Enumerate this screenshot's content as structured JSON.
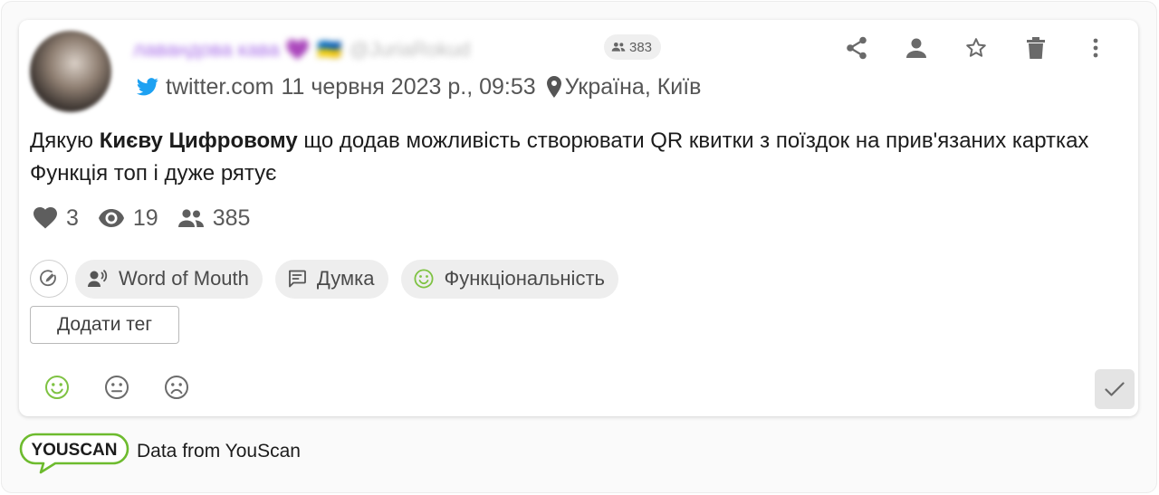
{
  "post": {
    "author_name": "лавандова кава 💜",
    "author_handle": "@JuriaRokud",
    "author_emoji": "🇺🇦",
    "audience": "383",
    "source": "twitter.com",
    "date": "11 червня 2023 р., 09:53",
    "location": "Україна, Київ",
    "text_before": "Дякую ",
    "text_bold": "Києву Цифровому",
    "text_after": " що додав можливість створювати QR квитки з поїздок на прив'язаних картках Функція топ і дуже рятує"
  },
  "stats": {
    "likes": "3",
    "views": "19",
    "reach": "385"
  },
  "tags": [
    {
      "label": "Word of Mouth",
      "icon": "speaker-person-icon"
    },
    {
      "label": "Думка",
      "icon": "comment-icon"
    },
    {
      "label": "Функціональність",
      "icon": "smile-icon",
      "icon_color": "#7ec242"
    }
  ],
  "add_tag_label": "Додати тег",
  "actions": [
    "share-icon",
    "person-icon",
    "star-icon",
    "trash-icon",
    "more-vertical-icon"
  ],
  "sentiment": {
    "selected": "positive",
    "positive_color": "#7ec242",
    "neutral_color": "#6b6b6b"
  },
  "footer": {
    "logo_text": "YOUSCAN",
    "credit": "Data from YouScan",
    "logo_accent": "#6dbb2e"
  },
  "colors": {
    "twitter": "#1da1f2"
  }
}
